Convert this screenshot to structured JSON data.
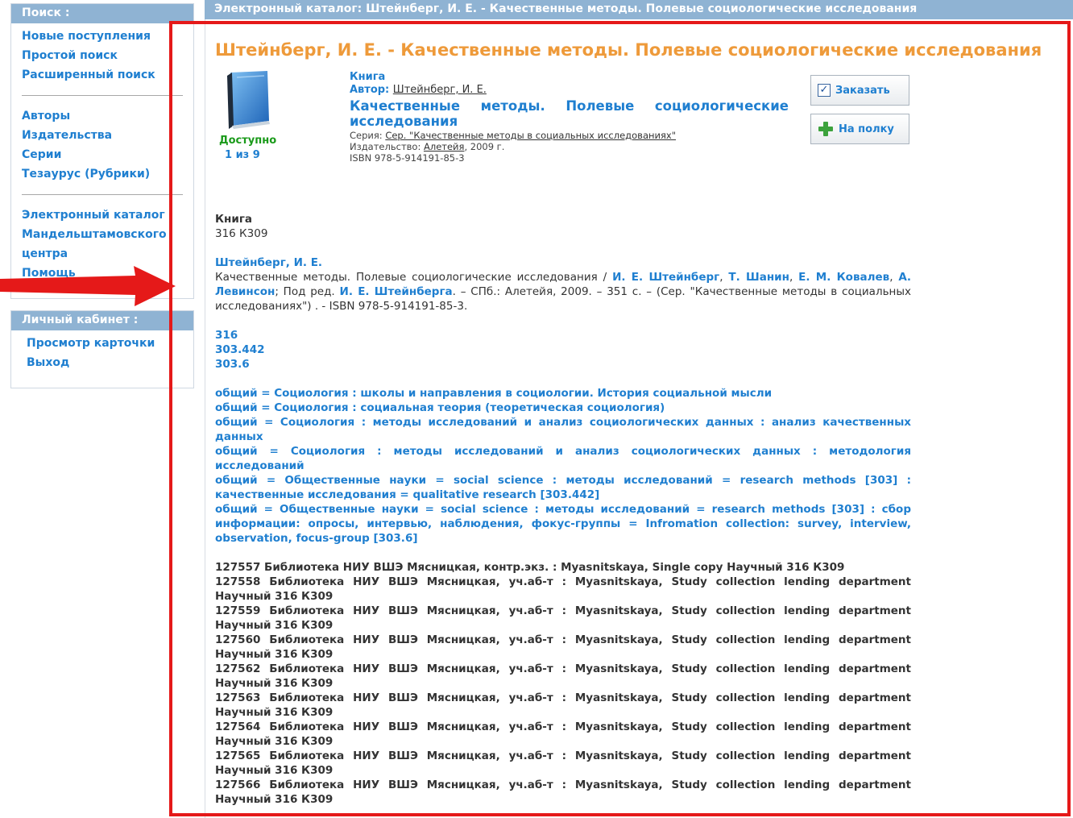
{
  "sidebar": {
    "search_header": "Поиск :",
    "search_links": [
      "Новые поступления",
      "Простой поиск",
      "Расширенный поиск"
    ],
    "browse_links": [
      "Авторы",
      "Издательства",
      "Серии",
      "Тезаурус (Рубрики)"
    ],
    "other_links": [
      "Электронный каталог",
      "Мандельштамовского",
      "центра",
      "Помощь"
    ],
    "cabinet_header": "Личный кабинет :",
    "cabinet_links": [
      "Просмотр карточки",
      "Выход"
    ]
  },
  "header": {
    "breadcrumb": "Электронный каталог: Штейнберг, И. Е. - Качественные методы. Полевые социологические исследования"
  },
  "book": {
    "page_title": "Штейнберг, И. Е. - Качественные методы. Полевые социологические исследования",
    "icon": "book-icon",
    "availability": "Доступно",
    "availability_count": "1 из 9",
    "type": "Книга",
    "author_label": "Автор:",
    "author": "Штейнберг, И. Е.",
    "title": "Качественные методы. Полевые социологические исследования",
    "series_label": "Серия:",
    "series": "Сер. \"Качественные методы в социальных исследованиях\"",
    "publisher_label": "Издательство:",
    "publisher": "Алетейя",
    "publisher_year": ", 2009 г.",
    "isbn": "ISBN 978-5-914191-85-3"
  },
  "actions": {
    "order_label": "Заказать",
    "shelf_label": "На полку"
  },
  "record": {
    "type": "Книга",
    "shelf_code": "316 К309",
    "author_heading": "Штейнберг, И. Е.",
    "desc_1": "Качественные методы. Полевые социологические исследования / ",
    "author_1": "И. Е. Штейнберг",
    "sep_1": ", ",
    "author_2": "Т. Шанин",
    "sep_2": ", ",
    "author_3": "Е. М. Ковалев",
    "sep_3": ", ",
    "author_4": "А. Левинсон",
    "desc_2": "; Под ред. ",
    "editor": "И. Е. Штейнберга",
    "desc_3": ". – СПб.: Алетейя, 2009. – 351 с. – (Сер. \"Качественные методы в социальных исследованиях\") . - ISBN 978-5-914191-85-3.",
    "udc": [
      "316",
      "303.442",
      "303.6"
    ],
    "subjects": [
      "общий = Социология : школы и направления в социологии. История социальной мысли",
      "общий = Социология : социальная теория (теоретическая социология)",
      "общий = Социология : методы исследований и анализ социологических данных : анализ качественных данных",
      "общий = Социология : методы исследований и анализ социологических данных : методология исследований",
      "общий = Общественные науки = social science : методы исследований = research methods [303] : качественные исследования = qualitative research [303.442]",
      "общий = Общественные науки = social science : методы исследований = research methods [303] : сбор информации: опросы, интервью, наблюдения, фокус-группы = Infromation collection: survey, interview, observation, focus-group [303.6]"
    ],
    "holdings": [
      "127557 Библиотека НИУ ВШЭ Мясницкая, контр.экз. : Myasnitskaya, Single copy Научный 316 К309",
      "127558 Библиотека НИУ ВШЭ Мясницкая, уч.аб-т : Myasnitskaya, Study collection lending department Научный 316 К309",
      "127559 Библиотека НИУ ВШЭ Мясницкая, уч.аб-т : Myasnitskaya, Study collection lending department Научный 316 К309",
      "127560 Библиотека НИУ ВШЭ Мясницкая, уч.аб-т : Myasnitskaya, Study collection lending department Научный 316 К309",
      "127562 Библиотека НИУ ВШЭ Мясницкая, уч.аб-т : Myasnitskaya, Study collection lending department Научный 316 К309",
      "127563 Библиотека НИУ ВШЭ Мясницкая, уч.аб-т : Myasnitskaya, Study collection lending department Научный 316 К309",
      "127564 Библиотека НИУ ВШЭ Мясницкая, уч.аб-т : Myasnitskaya, Study collection lending department Научный 316 К309",
      "127565 Библиотека НИУ ВШЭ Мясницкая, уч.аб-т : Myasnitskaya, Study collection lending department Научный 316 К309",
      "127566 Библиотека НИУ ВШЭ Мясницкая, уч.аб-т : Myasnitskaya, Study collection lending department Научный 316 К309"
    ]
  },
  "annotation": {
    "color": "#e51919"
  }
}
